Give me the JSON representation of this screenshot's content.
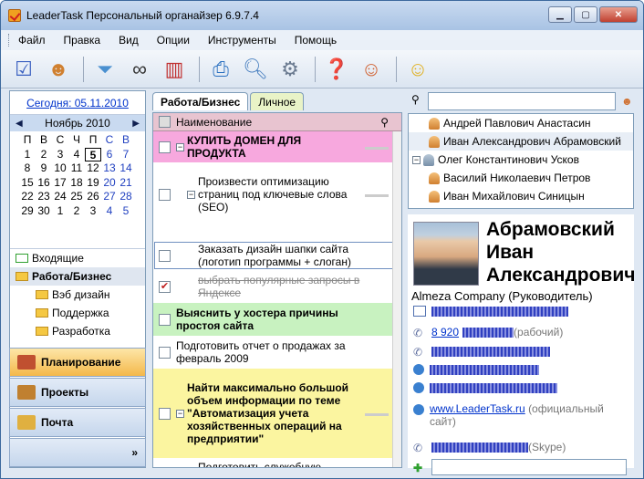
{
  "window": {
    "title": "LeaderTask Персональный органайзер 6.9.7.4"
  },
  "menu": [
    "Файл",
    "Правка",
    "Вид",
    "Опции",
    "Инструменты",
    "Помощь"
  ],
  "toolbar": {
    "icons": [
      "add-task-icon",
      "user-icon",
      "filter-icon",
      "binoculars-icon",
      "chart-icon",
      "print-icon",
      "preview-icon",
      "settings-icon",
      "help-icon",
      "users-icon",
      "notes-icon"
    ]
  },
  "left": {
    "today": "Сегодня: 05.11.2010",
    "month": "Ноябрь 2010",
    "prev": "◀",
    "next": "▶",
    "weekdays": [
      "П",
      "В",
      "С",
      "Ч",
      "П",
      "С",
      "В"
    ],
    "days": [
      [
        "1",
        "2",
        "3",
        "4",
        "5",
        "6",
        "7"
      ],
      [
        "8",
        "9",
        "10",
        "11",
        "12",
        "13",
        "14"
      ],
      [
        "15",
        "16",
        "17",
        "18",
        "19",
        "20",
        "21"
      ],
      [
        "22",
        "23",
        "24",
        "25",
        "26",
        "27",
        "28"
      ],
      [
        "29",
        "30",
        "1",
        "2",
        "3",
        "4",
        "5"
      ]
    ],
    "tree": [
      {
        "label": "Входящие",
        "bold": false,
        "indent": 0
      },
      {
        "label": "Работа/Бизнес",
        "bold": true,
        "indent": 0
      },
      {
        "label": "Вэб дизайн",
        "bold": false,
        "indent": 1
      },
      {
        "label": "Поддержка",
        "bold": false,
        "indent": 1
      },
      {
        "label": "Разработка",
        "bold": false,
        "indent": 1
      }
    ],
    "nav": [
      "Планирование",
      "Проекты",
      "Почта"
    ],
    "more": "»"
  },
  "mid": {
    "tabs": [
      "Работа/Бизнес",
      "Личное"
    ],
    "header": "Наименование",
    "tasks": [
      {
        "text": "КУПИТЬ ДОМЕН ДЛЯ ПРОДУКТА",
        "bg": "#f7a8de",
        "bold": true,
        "checked": false,
        "strike": false
      },
      {
        "text": "Произвести оптимизацию страниц под ключевые слова (SEO)",
        "bg": "#ffffff",
        "bold": false,
        "checked": false,
        "strike": false
      },
      {
        "text": "Заказать дизайн шапки сайта (логотип программы + слоган)",
        "bg": "#ffffff",
        "bold": false,
        "checked": false,
        "strike": false
      },
      {
        "text": "выбрать популярные запросы в Яндексе",
        "bg": "#ffffff",
        "bold": false,
        "checked": true,
        "strike": true
      },
      {
        "text": "Выяснить у хостера причины простоя сайта",
        "bg": "#c8f2c0",
        "bold": true,
        "checked": false,
        "strike": false
      },
      {
        "text": "Подготовить отчет о продажах за февраль 2009",
        "bg": "#ffffff",
        "bold": false,
        "checked": false,
        "strike": false
      },
      {
        "text": "Найти максимально большой объем информации по теме \"Автоматизация учета хозяйственных операций на предприятии\"",
        "bg": "#fbf5a0",
        "bold": true,
        "checked": false,
        "strike": false
      },
      {
        "text": "Подготовить служебную записку в отдел продаж",
        "bg": "#ffffff",
        "bold": false,
        "checked": false,
        "strike": false
      }
    ]
  },
  "right": {
    "contacts": [
      {
        "name": "Андрей Павлович Анастасин",
        "indent": 1
      },
      {
        "name": "Иван Александрович Абрамовский",
        "indent": 1
      },
      {
        "name": "Олег Константинович Усков",
        "indent": 0
      },
      {
        "name": "Василий Николаевич Петров",
        "indent": 1
      },
      {
        "name": "Иван Михайлович Синицын",
        "indent": 1
      }
    ],
    "card": {
      "name_lines": [
        "Абрамовский",
        "Иван",
        "Александрович"
      ],
      "company": "Almeza Company (Руководитель)",
      "phone_prefix": "8 920",
      "work_label": "(рабочий)",
      "site": "www.LeaderTask.ru",
      "site_label": "(официальный",
      "site_label2": "сайт)",
      "skype_label": "(Skype)"
    }
  },
  "colors": {
    "accent": "#0033cc",
    "selected_nav": "#f4b84a"
  }
}
